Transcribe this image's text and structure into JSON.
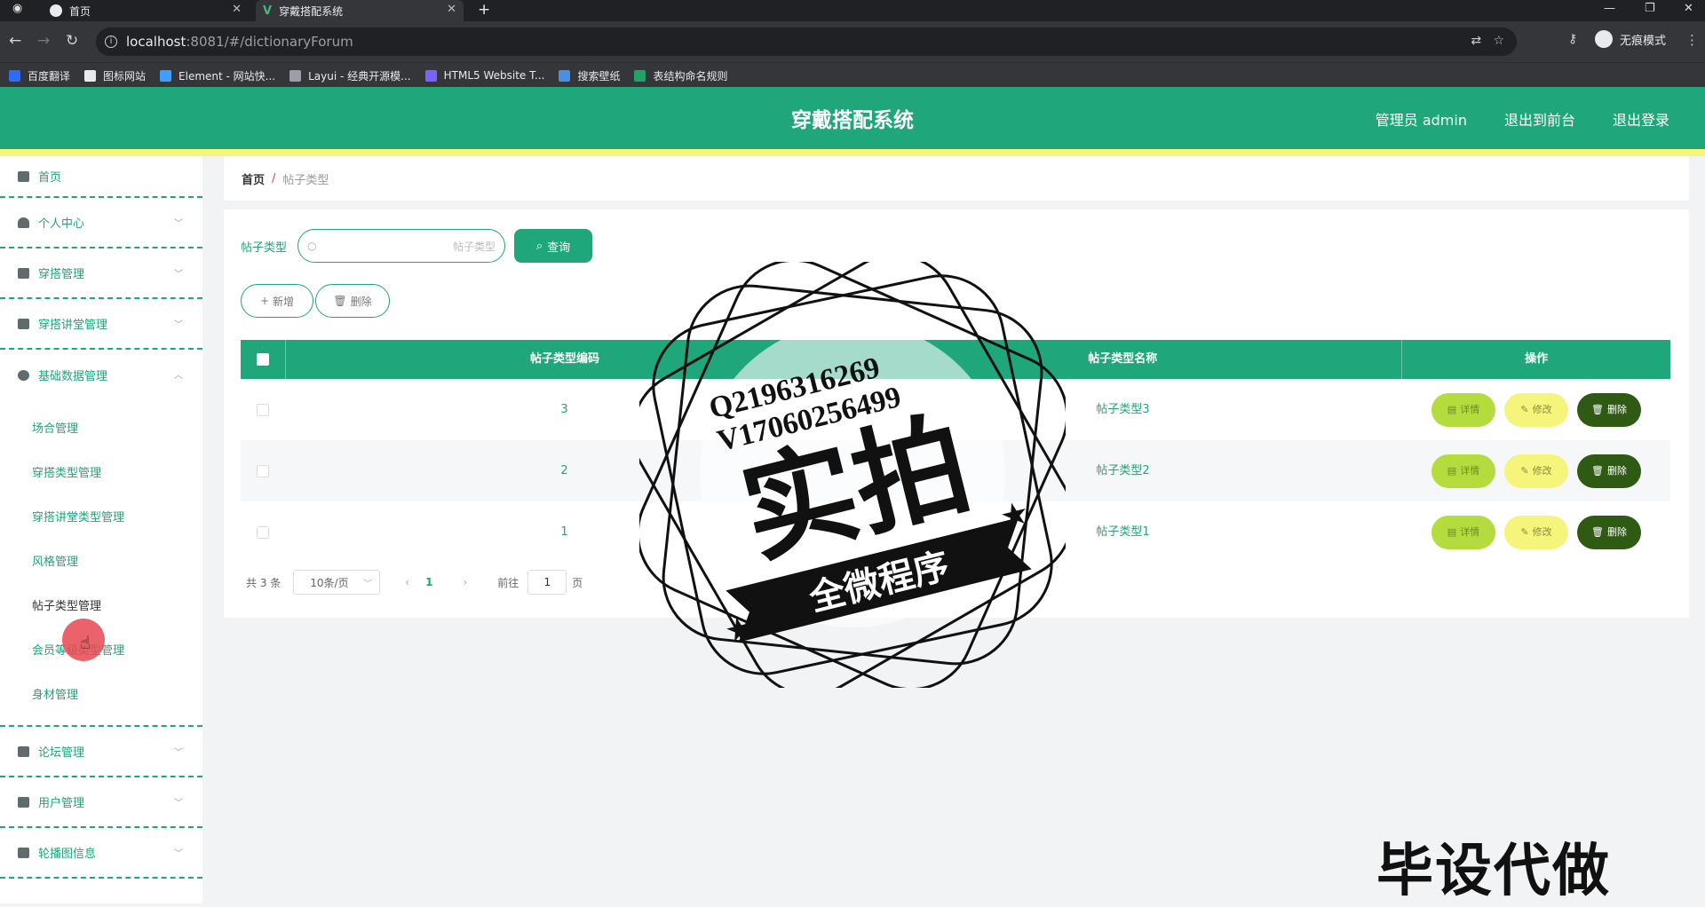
{
  "browser": {
    "tabs": [
      {
        "title": "首页"
      },
      {
        "title": "穿戴搭配系统"
      }
    ],
    "url_host": "localhost",
    "url_rest": ":8081/#/dictionaryForum",
    "profile_label": "无痕模式",
    "bookmarks": [
      {
        "label": "百度翻译",
        "color": "#2d6cf5"
      },
      {
        "label": "图标网站",
        "color": "#e8eaed"
      },
      {
        "label": "Element - 网站快...",
        "color": "#409eff"
      },
      {
        "label": "Layui - 经典开源模...",
        "color": "#9aa0a6"
      },
      {
        "label": "HTML5 Website T...",
        "color": "#7b61ff"
      },
      {
        "label": "搜索壁纸",
        "color": "#4a90e2"
      },
      {
        "label": "表结构命名规则",
        "color": "#21a366"
      }
    ]
  },
  "header": {
    "title": "穿戴搭配系统",
    "user": "管理员 admin",
    "front_link": "退出到前台",
    "logout": "退出登录",
    "accent": "#1fa67a",
    "strip": "#f7f57a"
  },
  "sidebar": {
    "home": "首页",
    "groups_top": [
      {
        "label": "个人中心"
      },
      {
        "label": "穿搭管理"
      },
      {
        "label": "穿搭讲堂管理"
      },
      {
        "label": "基础数据管理"
      }
    ],
    "subitems": [
      {
        "label": "场合管理"
      },
      {
        "label": "穿搭类型管理"
      },
      {
        "label": "穿搭讲堂类型管理"
      },
      {
        "label": "风格管理"
      },
      {
        "label": "帖子类型管理"
      },
      {
        "label": "会员等级类型管理"
      },
      {
        "label": "身材管理"
      }
    ],
    "groups_bottom": [
      {
        "label": "论坛管理"
      },
      {
        "label": "用户管理"
      },
      {
        "label": "轮播图信息"
      }
    ]
  },
  "breadcrumb": {
    "home": "首页",
    "separator": "/",
    "current": "帖子类型"
  },
  "search": {
    "label": "帖子类型",
    "placeholder": "帖子类型",
    "query_btn": "查询"
  },
  "actions": {
    "add": "新增",
    "delete": "删除"
  },
  "table": {
    "columns": {
      "code": "帖子类型编码",
      "name": "帖子类型名称",
      "ops": "操作"
    },
    "rows": [
      {
        "code": "3",
        "name": "帖子类型3"
      },
      {
        "code": "2",
        "name": "帖子类型2"
      },
      {
        "code": "1",
        "name": "帖子类型1"
      }
    ],
    "btn_detail": "详情",
    "btn_edit": "修改",
    "btn_delete": "删除"
  },
  "pager": {
    "total": "共 3 条",
    "page_size": "10条/页",
    "current": "1",
    "goto": "前往",
    "goto_value": "1",
    "page_unit": "页"
  },
  "overlay": {
    "qq": "Q2196316269",
    "vx": "V17060256499",
    "big": "实拍",
    "banner": "全微程序",
    "corner": "毕设代做"
  }
}
